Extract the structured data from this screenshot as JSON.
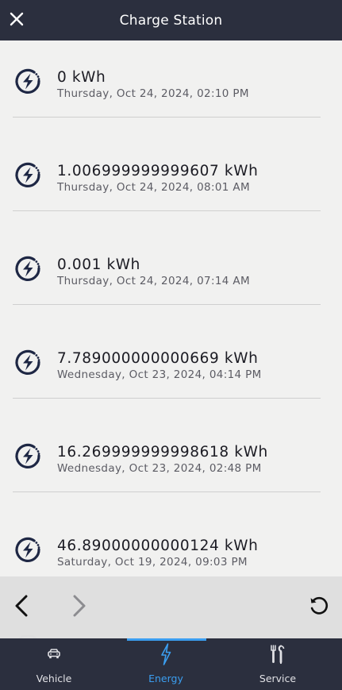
{
  "header": {
    "title": "Charge Station",
    "close_icon": "close-icon"
  },
  "sessions": [
    {
      "energy": "0 kWh",
      "date": "Thursday, Oct 24, 2024, 02:10 PM"
    },
    {
      "energy": "1.006999999999607 kWh",
      "date": "Thursday, Oct 24, 2024, 08:01 AM"
    },
    {
      "energy": "0.001 kWh",
      "date": "Thursday, Oct 24, 2024, 07:14 AM"
    },
    {
      "energy": "7.789000000000669 kWh",
      "date": "Wednesday, Oct 23, 2024, 04:14 PM"
    },
    {
      "energy": "16.269999999998618 kWh",
      "date": "Wednesday, Oct 23, 2024, 02:48 PM"
    },
    {
      "energy": "46.89000000000124 kWh",
      "date": "Saturday, Oct 19, 2024, 09:03 PM"
    }
  ],
  "browser_nav": {
    "back_icon": "chevron-left-icon",
    "forward_icon": "chevron-right-icon",
    "reload_icon": "reload-icon"
  },
  "tabs": [
    {
      "label": "Vehicle",
      "icon": "car-icon",
      "active": false
    },
    {
      "label": "Energy",
      "icon": "lightning-icon",
      "active": true
    },
    {
      "label": "Service",
      "icon": "tools-icon",
      "active": false
    }
  ],
  "colors": {
    "header_bg": "#2b2f3e",
    "background": "#f1f1f0",
    "accent": "#3b9ef0",
    "icon_navy": "#1e2744"
  }
}
